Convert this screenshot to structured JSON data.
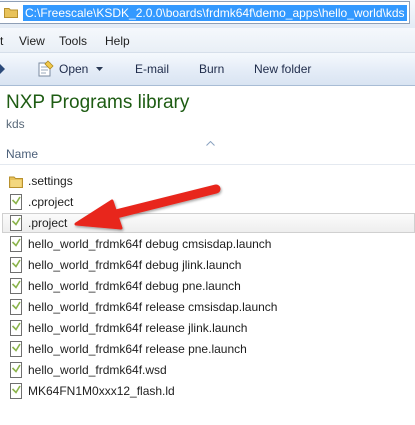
{
  "address_bar": {
    "path": "C:\\Freescale\\KSDK_2.0.0\\boards\\frdmk64f\\demo_apps\\hello_world\\kds"
  },
  "menu": {
    "view": "View",
    "tools": "Tools",
    "help": "Help"
  },
  "command_bar": {
    "open": "Open",
    "email": "E-mail",
    "burn": "Burn",
    "new_folder": "New folder"
  },
  "library": {
    "title": "NXP Programs library",
    "subtitle": "kds"
  },
  "columns": {
    "name": "Name"
  },
  "files": [
    {
      "name": ".settings",
      "type": "folder"
    },
    {
      "name": ".cproject",
      "type": "file"
    },
    {
      "name": ".project",
      "type": "file",
      "selected": true
    },
    {
      "name": "hello_world_frdmk64f debug cmsisdap.launch",
      "type": "file"
    },
    {
      "name": "hello_world_frdmk64f debug jlink.launch",
      "type": "file"
    },
    {
      "name": "hello_world_frdmk64f debug pne.launch",
      "type": "file"
    },
    {
      "name": "hello_world_frdmk64f release cmsisdap.launch",
      "type": "file"
    },
    {
      "name": "hello_world_frdmk64f release jlink.launch",
      "type": "file"
    },
    {
      "name": "hello_world_frdmk64f release pne.launch",
      "type": "file"
    },
    {
      "name": "hello_world_frdmk64f.wsd",
      "type": "file"
    },
    {
      "name": "MK64FN1M0xxx12_flash.ld",
      "type": "file"
    }
  ],
  "colors": {
    "address_highlight": "#3399ff",
    "library_title": "#1e5c13",
    "annotation_arrow": "#e8261e",
    "folder": "#e8c25a"
  }
}
